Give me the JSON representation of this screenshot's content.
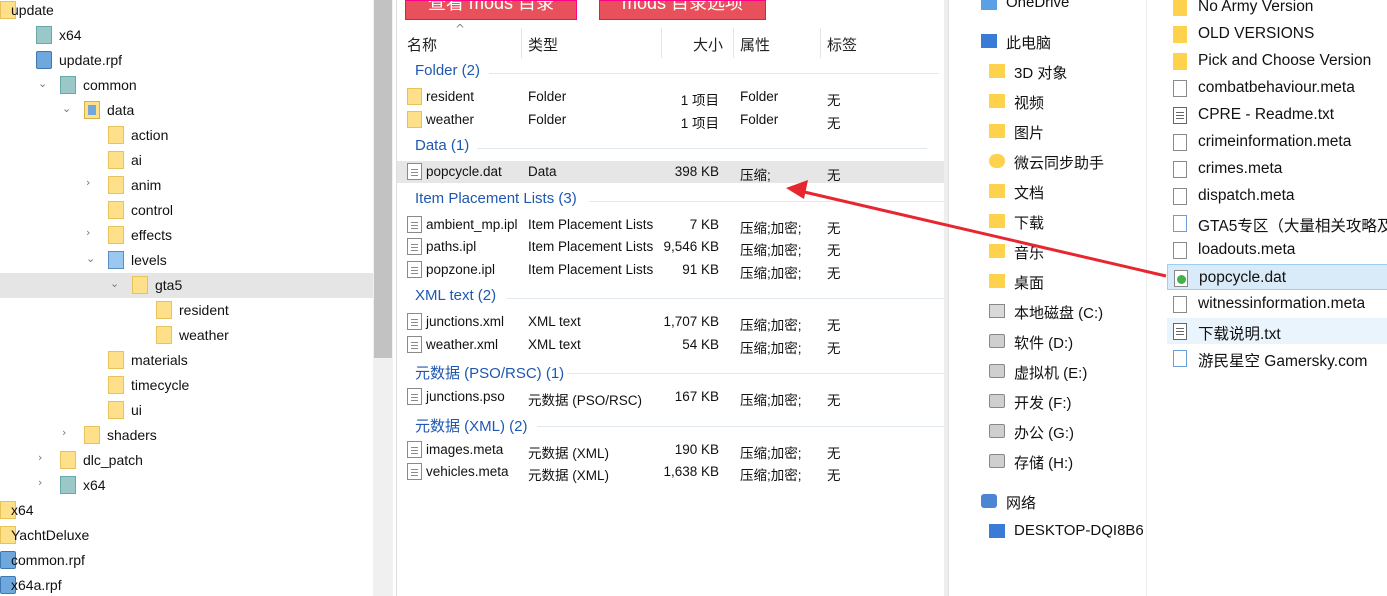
{
  "tree": {
    "items": [
      {
        "label": "update",
        "depth": 0,
        "icon": "folder",
        "chev": ""
      },
      {
        "label": "x64",
        "depth": 1,
        "icon": "file",
        "chev": ""
      },
      {
        "label": "update.rpf",
        "depth": 1,
        "icon": "rpf",
        "chev": ""
      },
      {
        "label": "common",
        "depth": 2,
        "icon": "file",
        "chev": "down"
      },
      {
        "label": "data",
        "depth": 3,
        "icon": "openfolder",
        "chev": "down"
      },
      {
        "label": "action",
        "depth": 4,
        "icon": "folder",
        "chev": ""
      },
      {
        "label": "ai",
        "depth": 4,
        "icon": "folder",
        "chev": ""
      },
      {
        "label": "anim",
        "depth": 4,
        "icon": "folder",
        "chev": "right"
      },
      {
        "label": "control",
        "depth": 4,
        "icon": "folder",
        "chev": ""
      },
      {
        "label": "effects",
        "depth": 4,
        "icon": "folder",
        "chev": "right"
      },
      {
        "label": "levels",
        "depth": 4,
        "icon": "levels",
        "chev": "down"
      },
      {
        "label": "gta5",
        "depth": 5,
        "icon": "folder",
        "chev": "down",
        "selected": true
      },
      {
        "label": "resident",
        "depth": 6,
        "icon": "folder",
        "chev": ""
      },
      {
        "label": "weather",
        "depth": 6,
        "icon": "folder",
        "chev": ""
      },
      {
        "label": "materials",
        "depth": 4,
        "icon": "folder",
        "chev": ""
      },
      {
        "label": "timecycle",
        "depth": 4,
        "icon": "folder",
        "chev": ""
      },
      {
        "label": "ui",
        "depth": 4,
        "icon": "folder",
        "chev": ""
      },
      {
        "label": "shaders",
        "depth": 3,
        "icon": "folder",
        "chev": "right"
      },
      {
        "label": "dlc_patch",
        "depth": 2,
        "icon": "folder",
        "chev": "right"
      },
      {
        "label": "x64",
        "depth": 2,
        "icon": "file",
        "chev": "right"
      },
      {
        "label": "x64",
        "depth": 0,
        "icon": "folder",
        "chev": ""
      },
      {
        "label": "YachtDeluxe",
        "depth": 0,
        "icon": "folder",
        "chev": ""
      },
      {
        "label": "common.rpf",
        "depth": 0,
        "icon": "rpf",
        "chev": ""
      },
      {
        "label": "x64a.rpf",
        "depth": 0,
        "icon": "rpf",
        "chev": ""
      }
    ]
  },
  "toolbar": {
    "btn1": "查看 mods 目录",
    "btn2": "mods 目录选项"
  },
  "columns": {
    "name": "名称",
    "type": "类型",
    "size": "大小",
    "attr": "属性",
    "tag": "标签"
  },
  "groups": [
    {
      "title": "Folder (2)",
      "rows": [
        {
          "name": "resident",
          "type": "Folder",
          "size": "1 项目",
          "attr": "Folder",
          "tag": "无",
          "icon": "folder"
        },
        {
          "name": "weather",
          "type": "Folder",
          "size": "1 项目",
          "attr": "Folder",
          "tag": "无",
          "icon": "folder"
        }
      ]
    },
    {
      "title": "Data (1)",
      "rows": [
        {
          "name": "popcycle.dat",
          "type": "Data",
          "size": "398 KB",
          "attr": "压缩;",
          "tag": "无",
          "icon": "doc",
          "highlight": true
        }
      ]
    },
    {
      "title": "Item Placement Lists (3)",
      "rows": [
        {
          "name": "ambient_mp.ipl",
          "type": "Item Placement Lists",
          "size": "7 KB",
          "attr": "压缩;加密;",
          "tag": "无",
          "icon": "doc"
        },
        {
          "name": "paths.ipl",
          "type": "Item Placement Lists",
          "size": "9,546 KB",
          "attr": "压缩;加密;",
          "tag": "无",
          "icon": "doc"
        },
        {
          "name": "popzone.ipl",
          "type": "Item Placement Lists",
          "size": "91 KB",
          "attr": "压缩;加密;",
          "tag": "无",
          "icon": "doc"
        }
      ]
    },
    {
      "title": "XML text (2)",
      "rows": [
        {
          "name": "junctions.xml",
          "type": "XML text",
          "size": "1,707 KB",
          "attr": "压缩;加密;",
          "tag": "无",
          "icon": "doc"
        },
        {
          "name": "weather.xml",
          "type": "XML text",
          "size": "54 KB",
          "attr": "压缩;加密;",
          "tag": "无",
          "icon": "doc"
        }
      ]
    },
    {
      "title": "元数据 (PSO/RSC) (1)",
      "rows": [
        {
          "name": "junctions.pso",
          "type": "元数据 (PSO/RSC)",
          "size": "167 KB",
          "attr": "压缩;加密;",
          "tag": "无",
          "icon": "doc"
        }
      ]
    },
    {
      "title": "元数据 (XML) (2)",
      "rows": [
        {
          "name": "images.meta",
          "type": "元数据 (XML)",
          "size": "190 KB",
          "attr": "压缩;加密;",
          "tag": "无",
          "icon": "doc"
        },
        {
          "name": "vehicles.meta",
          "type": "元数据 (XML)",
          "size": "1,638 KB",
          "attr": "压缩;加密;",
          "tag": "无",
          "icon": "doc"
        }
      ]
    }
  ],
  "nav": {
    "items": [
      {
        "label": "OneDrive",
        "icon": "cloud-blue",
        "indent": 0
      },
      {
        "label": "此电脑",
        "icon": "pc",
        "indent": 0
      },
      {
        "label": "3D 对象",
        "icon": "folder",
        "indent": 1
      },
      {
        "label": "视频",
        "icon": "folder",
        "indent": 1
      },
      {
        "label": "图片",
        "icon": "folder",
        "indent": 1
      },
      {
        "label": "微云同步助手",
        "icon": "cloud",
        "indent": 1
      },
      {
        "label": "文档",
        "icon": "folder",
        "indent": 1
      },
      {
        "label": "下载",
        "icon": "folder",
        "indent": 1
      },
      {
        "label": "音乐",
        "icon": "folder",
        "indent": 1
      },
      {
        "label": "桌面",
        "icon": "folder",
        "indent": 1
      },
      {
        "label": "本地磁盘 (C:)",
        "icon": "windrive",
        "indent": 1
      },
      {
        "label": "软件 (D:)",
        "icon": "drive",
        "indent": 1
      },
      {
        "label": "虚拟机 (E:)",
        "icon": "drive",
        "indent": 1
      },
      {
        "label": "开发 (F:)",
        "icon": "drive",
        "indent": 1
      },
      {
        "label": "办公 (G:)",
        "icon": "drive",
        "indent": 1
      },
      {
        "label": "存储 (H:)",
        "icon": "drive",
        "indent": 1
      },
      {
        "label": "网络",
        "icon": "net",
        "indent": 0
      },
      {
        "label": "DESKTOP-DQI8B6",
        "icon": "pc",
        "indent": 1
      }
    ]
  },
  "files": {
    "items": [
      {
        "label": "No Army Version",
        "icon": "folder"
      },
      {
        "label": "OLD VERSIONS",
        "icon": "folder"
      },
      {
        "label": "Pick and Choose Version",
        "icon": "folder"
      },
      {
        "label": "combatbehaviour.meta",
        "icon": "doc"
      },
      {
        "label": "CPRE - Readme.txt",
        "icon": "txt"
      },
      {
        "label": "crimeinformation.meta",
        "icon": "doc"
      },
      {
        "label": "crimes.meta",
        "icon": "doc"
      },
      {
        "label": "dispatch.meta",
        "icon": "doc"
      },
      {
        "label": "GTA5专区（大量相关攻略及",
        "icon": "link"
      },
      {
        "label": "loadouts.meta",
        "icon": "doc"
      },
      {
        "label": "popcycle.dat",
        "icon": "dat",
        "selected": true
      },
      {
        "label": "witnessinformation.meta",
        "icon": "doc"
      },
      {
        "label": "下载说明.txt",
        "icon": "txt",
        "soft": true
      },
      {
        "label": "游民星空 Gamersky.com",
        "icon": "link"
      }
    ]
  },
  "colors": {
    "arrow": "#e8262f",
    "group_title": "#1e58b0",
    "button_bg": "#e8505b",
    "selection": "#d9ebf9"
  }
}
